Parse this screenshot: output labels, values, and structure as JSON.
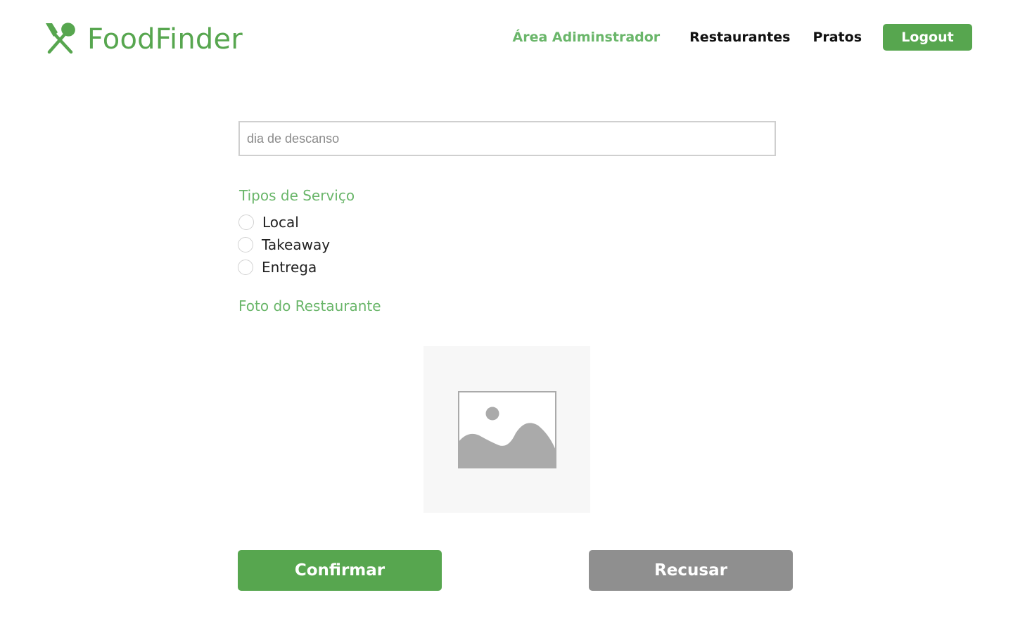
{
  "brand": {
    "name": "FoodFinder",
    "icon": "utensils-icon",
    "color": "#57a64f"
  },
  "nav": {
    "admin_area": "Área Adiminstrador",
    "restaurants": "Restaurantes",
    "dishes": "Pratos",
    "logout": "Logout"
  },
  "form": {
    "rest_day_placeholder": "dia de descanso",
    "service_types_label": "Tipos de Serviço",
    "service_options": [
      {
        "label": "Local",
        "selected": false
      },
      {
        "label": "Takeaway",
        "selected": false
      },
      {
        "label": "Entrega",
        "selected": false
      }
    ],
    "photo_label": "Foto do Restaurante",
    "photo_icon": "image-placeholder-icon"
  },
  "actions": {
    "confirm": "Confirmar",
    "refuse": "Recusar"
  },
  "colors": {
    "accent": "#57a64f",
    "accent_light": "#6ab66a",
    "secondary_button": "#8f8f8f"
  }
}
